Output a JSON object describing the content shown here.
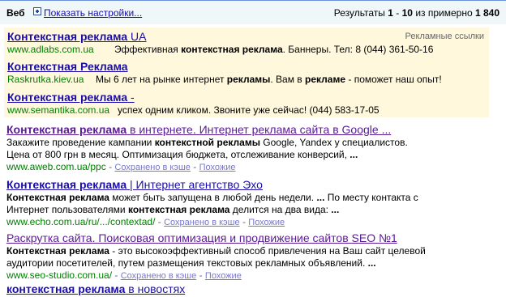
{
  "header": {
    "web_label": "Веб",
    "settings_link": "Показать настройки...",
    "results_prefix": "Результаты ",
    "results_range_from": "1",
    "results_dash": " - ",
    "results_range_to": "10",
    "results_mid": " из примерно ",
    "results_total": "1 840"
  },
  "ads": {
    "label": "Рекламные ссылки",
    "items": [
      {
        "title_bold": "Контекстная реклама",
        "title_rest": " UA",
        "url": "www.adlabs.com.ua",
        "desc_pre": "Эффективная ",
        "desc_bold": "контекстная реклама",
        "desc_post": ". Баннеры. Тел: 8 (044) 361-50-16"
      },
      {
        "title_bold": "Контекстная Реклама",
        "title_rest": "",
        "url": "Raskrutka.kiev.ua",
        "desc_pre": "Мы 6 лет на рынке интернет ",
        "desc_bold": "рекламы",
        "desc_mid": ". Вам в ",
        "desc_bold2": "рекламе",
        "desc_post": " - поможет наш опыт!"
      },
      {
        "title_bold": "Контекстная реклама",
        "title_rest": " -",
        "url": "www.semantika.com.ua",
        "desc_pre": "успех одним кликом. Звоните уже сейчас! (044) 583-17-05",
        "desc_bold": "",
        "desc_post": ""
      }
    ]
  },
  "results": [
    {
      "title_bold": "Контекстная реклама",
      "title_rest": " в интернете. Интернет реклама сайта в Google ...",
      "snippet_l1_pre": "Закажите проведение кампании ",
      "snippet_l1_bold": "контекстной рекламы",
      "snippet_l1_post": " Google, Yandex у специалистов.",
      "snippet_l2_pre": "Цена от 800 грн в месяц. Оптимизация бюджета, отслеживание конверсий, ",
      "snippet_l2_bold": "...",
      "url": "www.aweb.com.ua/ppc",
      "cache": "Сохранено в кэше",
      "similar": "Похожие"
    },
    {
      "title_bold": "Контекстная реклама",
      "title_rest": " | Интернет агентство Эхо",
      "snippet_l1_bold": "Контекстная реклама",
      "snippet_l1_post": " может быть запущена в любой день недели. ",
      "snippet_l1_bold2": "...",
      "snippet_l1_post2": " По месту контакта с",
      "snippet_l2_pre": "Интернет пользователями ",
      "snippet_l2_bold": "контекстная реклама",
      "snippet_l2_post": " делится на два вида: ",
      "snippet_l2_bold2": "...",
      "url": "www.echo.com.ua/ru/.../contextad/",
      "cache": "Сохранено в кэше",
      "similar": "Похожие"
    },
    {
      "title_rest": "Раскрутка сайта. Поисковая оптимизация и продвижение сайтов SEO №1",
      "snippet_l1_bold": "Контекстная реклама",
      "snippet_l1_post": " - это высокоэффективный способ привлечения на Ваш сайт целевой",
      "snippet_l2_pre": "аудитории посетителей, путем размещения текстовых рекламных объявлений. ",
      "snippet_l2_bold": "...",
      "url": "www.seo-studio.com.ua/",
      "cache": "Сохранено в кэше",
      "similar": "Похожие"
    },
    {
      "title_bold": "контекстная реклама",
      "title_rest": " в новостях"
    }
  ],
  "separator": " - "
}
